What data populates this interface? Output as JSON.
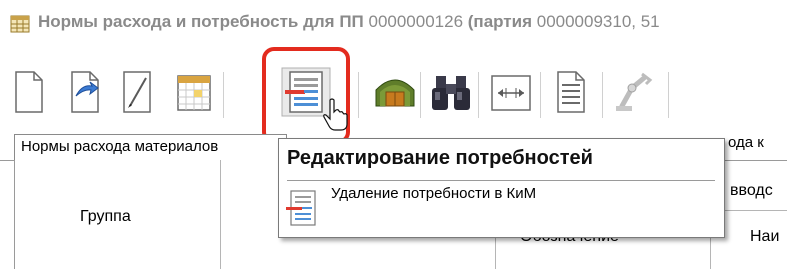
{
  "window": {
    "title_bold": "Нормы расхода и потребность для ПП",
    "title_rest": " 0000000126 ",
    "title_bold2": "(партия",
    "title_rest2": " 0000009310, 51"
  },
  "toolbar": {
    "buttons": [
      {
        "name": "new-document"
      },
      {
        "name": "copy-document"
      },
      {
        "name": "edit"
      },
      {
        "name": "calendar"
      },
      {
        "name": "edit-requirements"
      },
      {
        "name": "warehouse"
      },
      {
        "name": "find"
      },
      {
        "name": "fit-width"
      },
      {
        "name": "report"
      },
      {
        "name": "robot"
      }
    ],
    "highlight_color": "#e32b1e"
  },
  "tabs": {
    "active_label": "Нормы расхода материалов",
    "right_label": "ода к"
  },
  "grid": {
    "col_group": "Группа",
    "col_designation": "Обозначение",
    "col_name": "Наи",
    "col_transfer": "вводс"
  },
  "tooltip": {
    "title": "Редактирование потребностей",
    "item": "Удаление потребности в КиМ"
  }
}
